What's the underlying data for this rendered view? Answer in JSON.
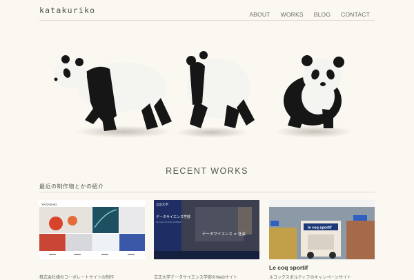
{
  "site": {
    "logo": "katakuriko"
  },
  "nav": {
    "items": [
      "ABOUT",
      "WORKS",
      "BLOG",
      "CONTACT"
    ]
  },
  "works": {
    "heading": "RECENT WORKS",
    "subheading": "最近の制作物とかの紹介",
    "items": [
      {
        "title": "",
        "desc": "株式会社様のコーポレートサイトの制作"
      },
      {
        "title": "",
        "desc": "立正大学データサイエンス学部のWebサイト"
      },
      {
        "title": "Le coq sportif",
        "desc": "ルコックスポルティフのキャンペーンサイト"
      }
    ],
    "thumb_text": {
      "rissho_name": "立正大学",
      "rissho_faculty": "データサイエンス学部",
      "rissho_en": "Faculty of DATA SCIENCE",
      "rissho_banner": "データサイエンス × 社会",
      "yagasaki": "YAGASAKI",
      "lecoq": "le coq sportif"
    }
  },
  "colors": {
    "background": "#fbf8f1",
    "rule": "#dedad2",
    "panda_black": "#161616",
    "panda_white": "#f4f4f1"
  }
}
